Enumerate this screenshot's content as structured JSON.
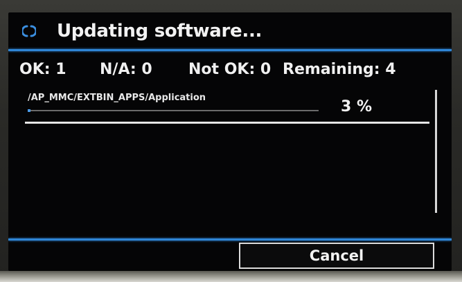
{
  "header": {
    "title": "Updating software...",
    "icon": "spinner-icon"
  },
  "stats": {
    "ok": "OK: 1",
    "na": "N/A: 0",
    "not_ok": "Not OK: 0",
    "remaining": "Remaining: 4"
  },
  "current_item": {
    "path": "/AP_MMC/EXTBIN_APPS/Application",
    "file_progress_fraction": 0.01,
    "percent_label": "3 %"
  },
  "actions": {
    "cancel_label": "Cancel"
  },
  "colors": {
    "accent": "#2f86d6",
    "background": "#050506",
    "text": "#f2f2f2"
  }
}
